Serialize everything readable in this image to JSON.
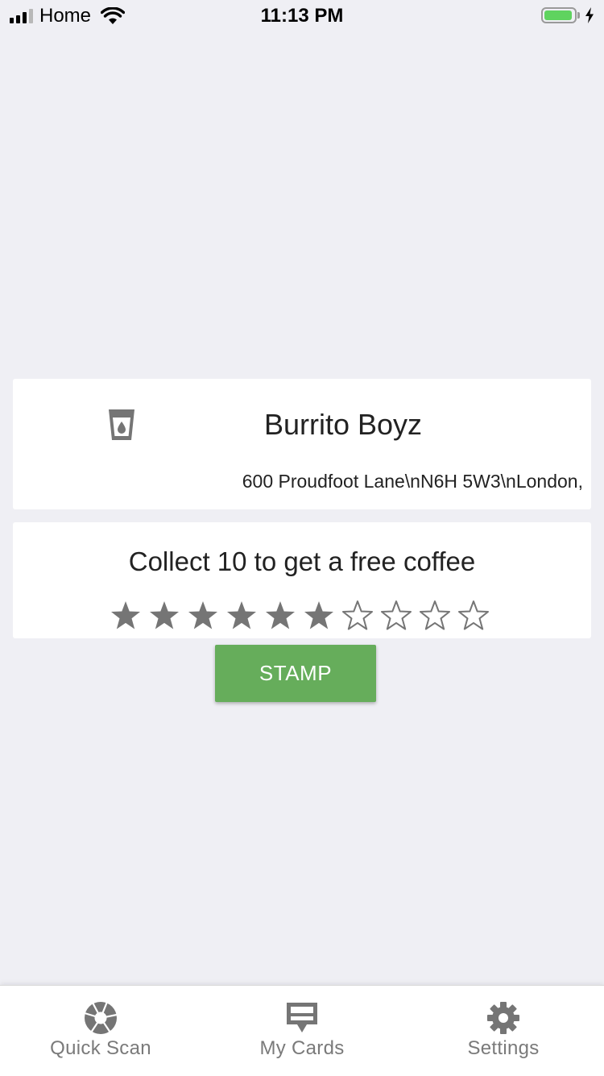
{
  "status_bar": {
    "carrier": "Home",
    "time": "11:13 PM",
    "battery_level": 0.95,
    "charging": true,
    "signal_bars_active": 3,
    "signal_bars_total": 4
  },
  "shop_card": {
    "icon": "cup-icon",
    "name": "Burrito Boyz",
    "address": "600 Proudfoot Lane\\nN6H 5W3\\nLondon,"
  },
  "stamp_card": {
    "promo": "Collect 10 to get a free coffee",
    "stamps_collected": 6,
    "stamps_total": 10
  },
  "actions": {
    "stamp_label": "STAMP",
    "stamp_color": "#66ad5b"
  },
  "tab_bar": {
    "tabs": [
      {
        "label": "Quick Scan",
        "icon": "camera-aperture-icon"
      },
      {
        "label": "My Cards",
        "icon": "cards-icon"
      },
      {
        "label": "Settings",
        "icon": "gear-icon"
      }
    ]
  },
  "colors": {
    "background": "#efeff4",
    "card": "#ffffff",
    "icon_gray": "#757575",
    "battery_green": "#5fd35f"
  }
}
